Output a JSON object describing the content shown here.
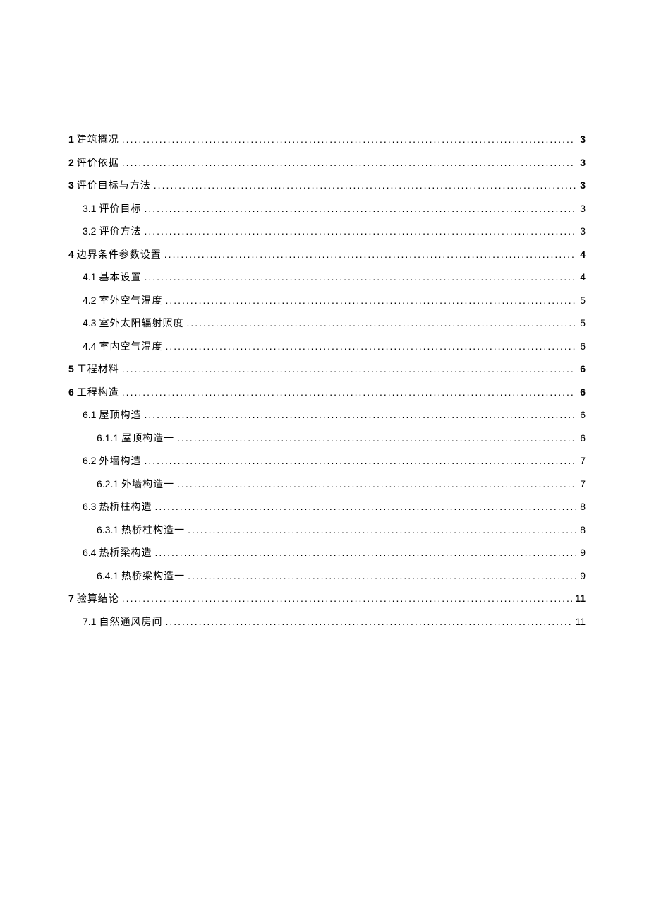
{
  "entries": [
    {
      "level": 0,
      "num": "1",
      "label": "建筑概况",
      "page": "3",
      "numBold": true,
      "pageBold": true
    },
    {
      "level": 0,
      "num": "2",
      "label": "评价依据",
      "page": "3",
      "numBold": true,
      "pageBold": true
    },
    {
      "level": 0,
      "num": "3",
      "label": "评价目标与方法",
      "page": "3",
      "numBold": true,
      "pageBold": true
    },
    {
      "level": 1,
      "num": "3.1",
      "label": "评价目标",
      "page": "3",
      "numBold": false,
      "pageBold": false
    },
    {
      "level": 1,
      "num": "3.2",
      "label": "评价方法",
      "page": "3",
      "numBold": false,
      "pageBold": false
    },
    {
      "level": 0,
      "num": "4",
      "label": "边界条件参数设置",
      "page": "4",
      "numBold": true,
      "pageBold": true
    },
    {
      "level": 1,
      "num": "4.1",
      "label": "基本设置",
      "page": "4",
      "numBold": false,
      "pageBold": false
    },
    {
      "level": 1,
      "num": "4.2",
      "label": "室外空气温度",
      "page": "5",
      "numBold": false,
      "pageBold": false
    },
    {
      "level": 1,
      "num": "4.3",
      "label": "室外太阳辐射照度",
      "page": "5",
      "numBold": false,
      "pageBold": false
    },
    {
      "level": 1,
      "num": "4.4",
      "label": "室内空气温度",
      "page": "6",
      "numBold": false,
      "pageBold": false
    },
    {
      "level": 0,
      "num": "5",
      "label": "工程材料",
      "page": "6",
      "numBold": true,
      "pageBold": true
    },
    {
      "level": 0,
      "num": "6",
      "label": "工程构造",
      "page": "6",
      "numBold": true,
      "pageBold": true
    },
    {
      "level": 1,
      "num": "6.1",
      "label": "屋顶构造",
      "page": "6",
      "numBold": false,
      "pageBold": false
    },
    {
      "level": 2,
      "num": "6.1.1",
      "label": "屋顶构造一",
      "page": "6",
      "numBold": false,
      "pageBold": false
    },
    {
      "level": 1,
      "num": "6.2",
      "label": "外墙构造",
      "page": "7",
      "numBold": false,
      "pageBold": false
    },
    {
      "level": 2,
      "num": "6.2.1",
      "label": "外墙构造一",
      "page": "7",
      "numBold": false,
      "pageBold": false
    },
    {
      "level": 1,
      "num": "6.3",
      "label": "热桥柱构造",
      "page": "8",
      "numBold": false,
      "pageBold": false
    },
    {
      "level": 2,
      "num": "6.3.1",
      "label": "热桥柱构造一",
      "page": "8",
      "numBold": false,
      "pageBold": false
    },
    {
      "level": 1,
      "num": "6.4",
      "label": "热桥梁构造",
      "page": "9",
      "numBold": false,
      "pageBold": false
    },
    {
      "level": 2,
      "num": "6.4.1",
      "label": "热桥梁构造一",
      "page": "9",
      "numBold": false,
      "pageBold": false
    },
    {
      "level": 0,
      "num": "7",
      "label": "验算结论",
      "page": "11",
      "numBold": true,
      "pageBold": true
    },
    {
      "level": 1,
      "num": "7.1",
      "label": "自然通风房间",
      "page": "11",
      "numBold": false,
      "pageBold": false
    }
  ]
}
